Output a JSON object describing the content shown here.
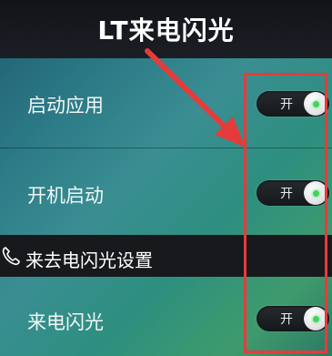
{
  "app": {
    "title": "LT来电闪光"
  },
  "settings": [
    {
      "label": "启动应用",
      "toggle_label": "开",
      "enabled": true
    },
    {
      "label": "开机启动",
      "toggle_label": "开",
      "enabled": true
    }
  ],
  "section": {
    "label": "来去电闪光设置",
    "icon": "phone-icon"
  },
  "section_settings": [
    {
      "label": "来电闪光",
      "toggle_label": "开",
      "enabled": true
    }
  ],
  "annotation": {
    "color": "#e63b3b",
    "type": "red-arrow-and-box"
  },
  "colors": {
    "accent_on": "#45d45a",
    "title_bar": "#17191d"
  }
}
